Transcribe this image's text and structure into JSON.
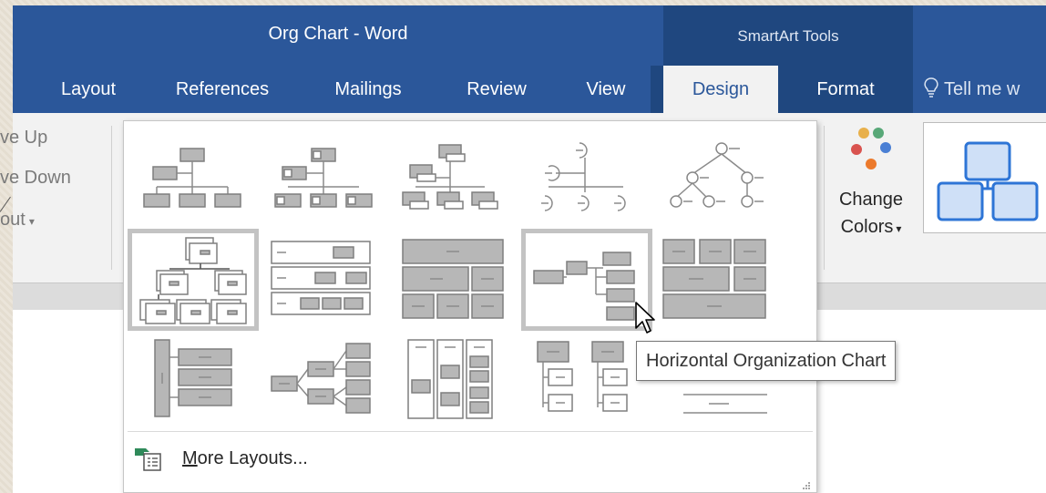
{
  "window": {
    "title": "Org Chart - Word",
    "contextual_group": "SmartArt Tools"
  },
  "tabs": [
    {
      "label": "Layout"
    },
    {
      "label": "References"
    },
    {
      "label": "Mailings"
    },
    {
      "label": "Review"
    },
    {
      "label": "View"
    },
    {
      "label": "Design",
      "active": true
    },
    {
      "label": "Format"
    }
  ],
  "tell_me": {
    "placeholder": "Tell me w",
    "icon": "lightbulb-icon"
  },
  "ribbon_left": {
    "move_up": "ve Up",
    "move_down": "ve Down",
    "layout": "out"
  },
  "change_colors": {
    "line1": "Change",
    "line2": "Colors"
  },
  "gallery": {
    "selected_index": 5,
    "hovered_index": 8,
    "items_count": 15,
    "more_layouts": "More Layouts..."
  },
  "tooltip": {
    "text": "Horizontal Organization Chart"
  },
  "colors": {
    "title_bar": "#2b579a",
    "contextual": "#1f477f",
    "ribbon": "#f2f2f2"
  }
}
